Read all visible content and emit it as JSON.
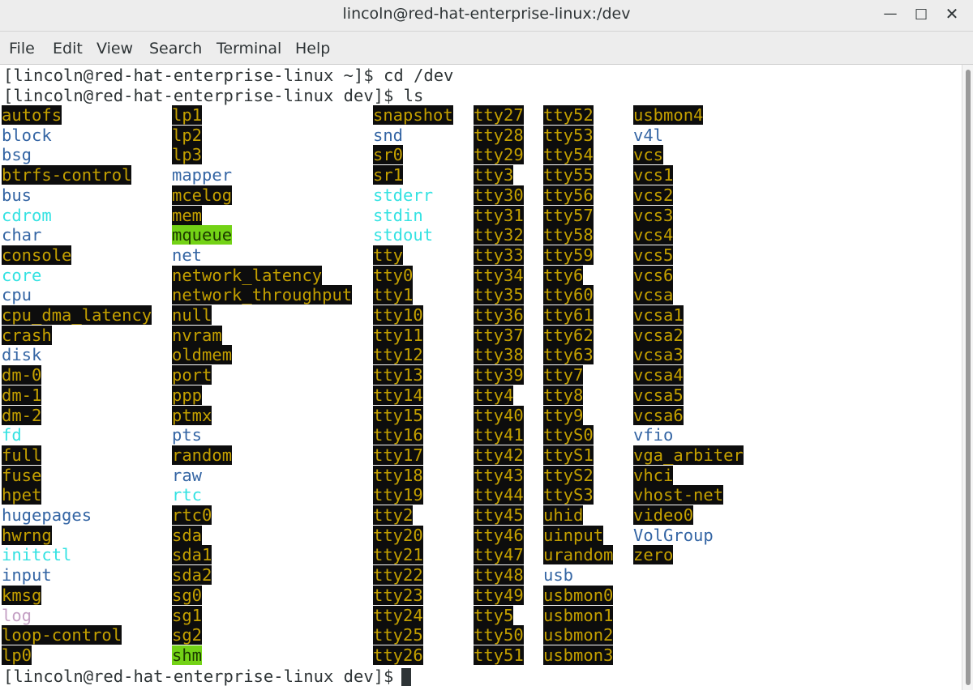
{
  "window": {
    "title": "lincoln@red-hat-enterprise-linux:/dev",
    "minimize_icon": "minimize-icon",
    "maximize_icon": "maximize-icon",
    "close_icon": "close-icon"
  },
  "menubar": {
    "items": [
      "File",
      "Edit",
      "View",
      "Search",
      "Terminal",
      "Help"
    ]
  },
  "terminal": {
    "lines": [
      "[lincoln@red-hat-enterprise-linux ~]$ cd /dev",
      "[lincoln@red-hat-enterprise-linux dev]$ ls"
    ],
    "prompt": "[lincoln@red-hat-enterprise-linux dev]$ ",
    "columns": [
      [
        "autofs",
        "block",
        "bsg",
        "btrfs-control",
        "bus",
        "cdrom",
        "char",
        "console",
        "core",
        "cpu",
        "cpu_dma_latency",
        "crash",
        "disk",
        "dm-0",
        "dm-1",
        "dm-2",
        "fd",
        "full",
        "fuse",
        "hpet",
        "hugepages",
        "hwrng",
        "initctl",
        "input",
        "kmsg",
        "log",
        "loop-control",
        "lp0"
      ],
      [
        "lp1",
        "lp2",
        "lp3",
        "mapper",
        "mcelog",
        "mem",
        "mqueue",
        "net",
        "network_latency",
        "network_throughput",
        "null",
        "nvram",
        "oldmem",
        "port",
        "ppp",
        "ptmx",
        "pts",
        "random",
        "raw",
        "rtc",
        "rtc0",
        "sda",
        "sda1",
        "sda2",
        "sg0",
        "sg1",
        "sg2",
        "shm"
      ],
      [
        "snapshot",
        "snd",
        "sr0",
        "sr1",
        "stderr",
        "stdin",
        "stdout",
        "tty",
        "tty0",
        "tty1",
        "tty10",
        "tty11",
        "tty12",
        "tty13",
        "tty14",
        "tty15",
        "tty16",
        "tty17",
        "tty18",
        "tty19",
        "tty2",
        "tty20",
        "tty21",
        "tty22",
        "tty23",
        "tty24",
        "tty25",
        "tty26"
      ],
      [
        "tty27",
        "tty28",
        "tty29",
        "tty3",
        "tty30",
        "tty31",
        "tty32",
        "tty33",
        "tty34",
        "tty35",
        "tty36",
        "tty37",
        "tty38",
        "tty39",
        "tty4",
        "tty40",
        "tty41",
        "tty42",
        "tty43",
        "tty44",
        "tty45",
        "tty46",
        "tty47",
        "tty48",
        "tty49",
        "tty5",
        "tty50",
        "tty51"
      ],
      [
        "tty52",
        "tty53",
        "tty54",
        "tty55",
        "tty56",
        "tty57",
        "tty58",
        "tty59",
        "tty6",
        "tty60",
        "tty61",
        "tty62",
        "tty63",
        "tty7",
        "tty8",
        "tty9",
        "ttyS0",
        "ttyS1",
        "ttyS2",
        "ttyS3",
        "uhid",
        "uinput",
        "urandom",
        "usb",
        "usbmon0",
        "usbmon1",
        "usbmon2",
        "usbmon3"
      ],
      [
        "usbmon4",
        "v4l",
        "vcs",
        "vcs1",
        "vcs2",
        "vcs3",
        "vcs4",
        "vcs5",
        "vcs6",
        "vcsa",
        "vcsa1",
        "vcsa2",
        "vcsa3",
        "vcsa4",
        "vcsa5",
        "vcsa6",
        "vfio",
        "vga_arbiter",
        "vhci",
        "vhost-net",
        "video0",
        "VolGroup",
        "zero"
      ]
    ],
    "styles": {
      "dir": [
        "block",
        "bsg",
        "bus",
        "char",
        "cpu",
        "disk",
        "hugepages",
        "input",
        "mapper",
        "net",
        "pts",
        "raw",
        "snd",
        "usb",
        "v4l",
        "vfio",
        "VolGroup"
      ],
      "link": [
        "cdrom",
        "core",
        "fd",
        "initctl",
        "rtc",
        "stderr",
        "stdin",
        "stdout"
      ],
      "sock": [
        "log"
      ],
      "sticky": [
        "mqueue",
        "shm"
      ],
      "yellow_on_black": [
        "sda",
        "sda1",
        "sda2",
        "sg0",
        "sg1",
        "sg2",
        "sr0",
        "sr1",
        "dm-0",
        "dm-1",
        "dm-2",
        "zero"
      ]
    },
    "colors": {
      "highlight_bg": "#0d0d0d",
      "highlight_fg": "#c4a000",
      "dir": "#3465a4",
      "link": "#34e2e2",
      "sticky_bg": "#73d216"
    }
  }
}
